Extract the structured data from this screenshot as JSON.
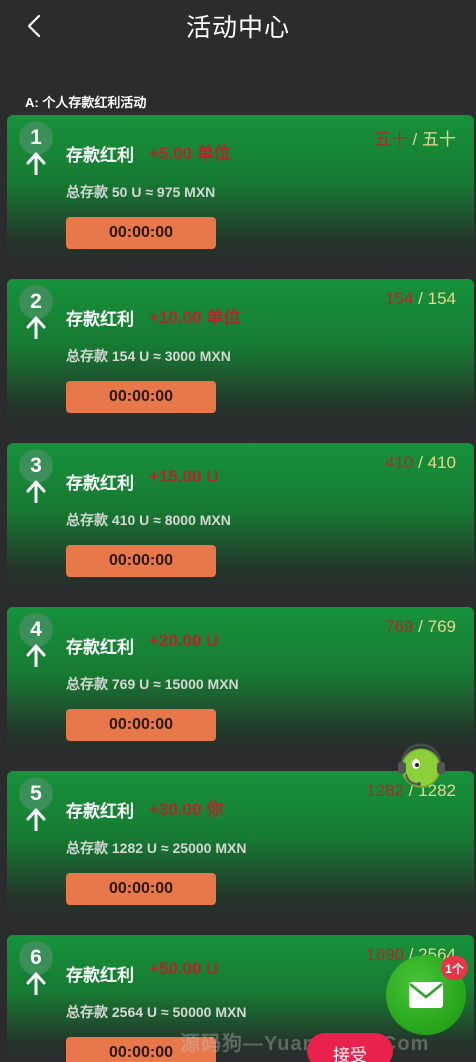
{
  "header": {
    "title": "活动中心"
  },
  "section": {
    "label": "A:  个人存款红利活动"
  },
  "cards": [
    {
      "index": "1",
      "name": "存款红利",
      "bonus": "+5.00 单位",
      "total": "总存款 50 U ≈ 975 MXN",
      "timer": "00:00:00",
      "progress_current": "五十",
      "progress_total": "五十"
    },
    {
      "index": "2",
      "name": "存款红利",
      "bonus": "+10.00 单位",
      "total": "总存款 154 U ≈ 3000 MXN",
      "timer": "00:00:00",
      "progress_current": "154",
      "progress_total": "154"
    },
    {
      "index": "3",
      "name": "存款红利",
      "bonus": "+15.00 U",
      "total": "总存款 410 U ≈ 8000 MXN",
      "timer": "00:00:00",
      "progress_current": "410",
      "progress_total": "410"
    },
    {
      "index": "4",
      "name": "存款红利",
      "bonus": "+20.00 U",
      "total": "总存款 769 U ≈ 15000 MXN",
      "timer": "00:00:00",
      "progress_current": "769",
      "progress_total": "769"
    },
    {
      "index": "5",
      "name": "存款红利",
      "bonus": "+30.00 你",
      "total": "总存款 1282 U ≈ 25000 MXN",
      "timer": "00:00:00",
      "progress_current": "1282",
      "progress_total": "1282"
    },
    {
      "index": "6",
      "name": "存款红利",
      "bonus": "+50.00 U",
      "total": "总存款 2564 U ≈ 50000 MXN",
      "timer": "00:00:00",
      "progress_current": "1690",
      "progress_total": "2564"
    }
  ],
  "mail": {
    "badge": "1个"
  },
  "accept": {
    "label": "接受"
  },
  "watermark": "源码狗—YuanMaGo.Com",
  "colors": {
    "accent_orange": "#e8774a",
    "card_green": "#17923a",
    "bonus_red": "#b3262a",
    "progress_gold": "#e8d88a"
  },
  "icons": {
    "back": "chevron-left-icon",
    "arrow": "arrow-up-icon",
    "mail": "envelope-icon",
    "float": "customer-service-icon"
  }
}
